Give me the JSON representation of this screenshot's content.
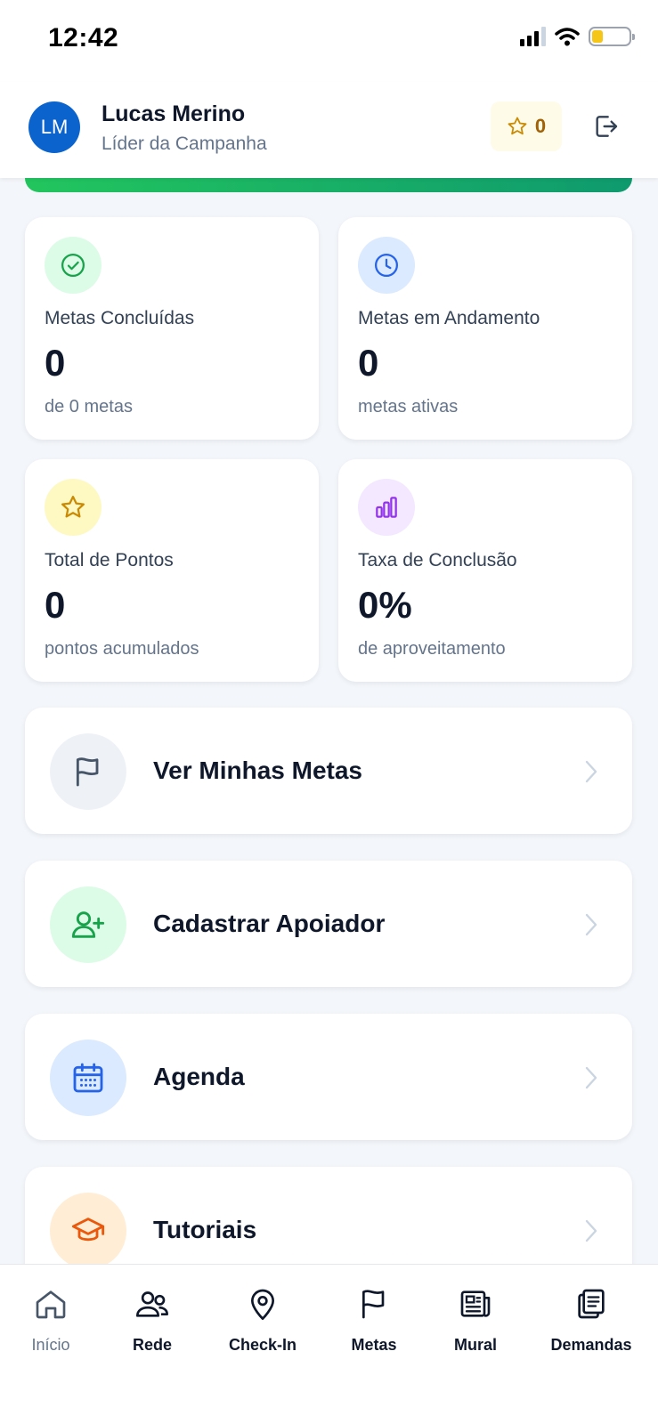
{
  "status": {
    "time": "12:42"
  },
  "header": {
    "avatar_initials": "LM",
    "user_name": "Lucas Merino",
    "user_role": "Líder da Campanha",
    "points": "0"
  },
  "stats": [
    {
      "label": "Metas Concluídas",
      "value": "0",
      "sub": "de 0 metas",
      "icon": "check-circle-icon",
      "color": "#16a34a",
      "bg": "#dcfce7"
    },
    {
      "label": "Metas em Andamento",
      "value": "0",
      "sub": "metas ativas",
      "icon": "clock-icon",
      "color": "#2563eb",
      "bg": "#dbeafe"
    },
    {
      "label": "Total de Pontos",
      "value": "0",
      "sub": "pontos acumulados",
      "icon": "star-icon",
      "color": "#ca8a04",
      "bg": "#fef9c3"
    },
    {
      "label": "Taxa de Conclusão",
      "value": "0%",
      "sub": "de aproveitamento",
      "icon": "bar-chart-icon",
      "color": "#9333ea",
      "bg": "#f3e8ff"
    }
  ],
  "menu": [
    {
      "label": "Ver Minhas Metas",
      "icon": "flag-icon"
    },
    {
      "label": "Cadastrar Apoiador",
      "icon": "user-plus-icon"
    },
    {
      "label": "Agenda",
      "icon": "calendar-icon"
    },
    {
      "label": "Tutoriais",
      "icon": "graduation-cap-icon"
    }
  ],
  "nav": [
    {
      "label": "Início",
      "icon": "home-icon",
      "active": true
    },
    {
      "label": "Rede",
      "icon": "users-icon"
    },
    {
      "label": "Check-In",
      "icon": "map-pin-icon"
    },
    {
      "label": "Metas",
      "icon": "flag-icon"
    },
    {
      "label": "Mural",
      "icon": "newspaper-icon"
    },
    {
      "label": "Demandas",
      "icon": "clipboard-list-icon"
    }
  ]
}
